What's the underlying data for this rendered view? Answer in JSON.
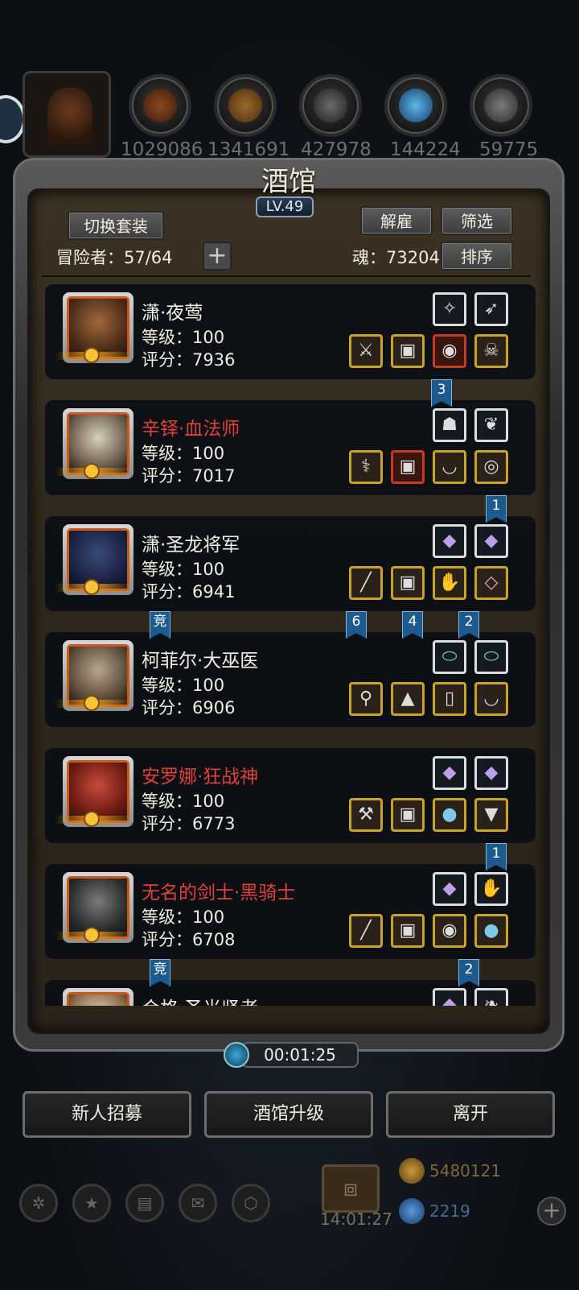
{
  "resources": [
    {
      "icon": "hero-portrait-icon",
      "value": ""
    },
    {
      "icon": "meat-icon",
      "value": "1029086"
    },
    {
      "icon": "wood-icon",
      "value": "1341691"
    },
    {
      "icon": "iron-icon",
      "value": "427978"
    },
    {
      "icon": "crystal-icon",
      "value": "144224"
    },
    {
      "icon": "steel-icon",
      "value": "59775"
    }
  ],
  "panel": {
    "title": "酒馆",
    "level": "LV.49",
    "switch_outfit": "切换套装",
    "dismiss": "解雇",
    "filter": "筛选",
    "sort": "排序",
    "adventurers": "冒险者：57/64",
    "plus": "+",
    "soul": "魂：73204"
  },
  "colors": {
    "name_default": "#f3efe6",
    "name_red": "#e0413a",
    "gold_frame": "#c9a227",
    "silver_frame": "#d9dde0",
    "flag_blue": "#1f5a8f"
  },
  "heroes": [
    {
      "name": "潇·夜莺",
      "name_color": "default",
      "level": "等级：100",
      "score": "评分：7936",
      "top_equip": [
        "sigil-icon",
        "bow-icon"
      ],
      "bottom_equip": [
        "dagger-icon",
        "armor-icon",
        "shield-icon",
        "skull-icon"
      ]
    },
    {
      "name": "辛铎·血法师",
      "name_color": "red",
      "level": "等级：100",
      "score": "评分：7017",
      "top_equip": [
        "mask-icon",
        "cloak-icon"
      ],
      "bottom_equip": [
        "staff-icon",
        "armor-icon",
        "necklace-icon",
        "ring-icon"
      ]
    },
    {
      "name": "潇·圣龙将军",
      "name_color": "default",
      "level": "等级：100",
      "score": "评分：6941",
      "top_equip": [
        "gem-icon",
        "gem-icon"
      ],
      "bottom_equip": [
        "spear-icon",
        "armor-icon",
        "gauntlet-icon",
        "rune-icon"
      ]
    },
    {
      "name": "柯菲尔·大巫医",
      "name_color": "default",
      "level": "等级：100",
      "score": "评分：6906",
      "top_equip": [
        "disk-icon",
        "disk-icon"
      ],
      "bottom_equip": [
        "wand-icon",
        "robe-icon",
        "bracer-icon",
        "necklace-icon"
      ]
    },
    {
      "name": "安罗娜·狂战神",
      "name_color": "red",
      "level": "等级：100",
      "score": "评分：6773",
      "top_equip": [
        "gem-icon",
        "gem-icon"
      ],
      "bottom_equip": [
        "axe-icon",
        "armor-icon",
        "orb-icon",
        "boot-icon"
      ]
    },
    {
      "name": "无名的剑士·黑骑士",
      "name_color": "red",
      "level": "等级：100",
      "score": "评分：6708",
      "top_equip": [
        "gem-icon",
        "glove-icon"
      ],
      "bottom_equip": [
        "sword-icon",
        "armor-icon",
        "shield-icon",
        "orb-icon"
      ]
    },
    {
      "name": "合格·圣光贤者",
      "name_color": "default",
      "level": "",
      "score": "",
      "top_equip": [
        "gem-icon",
        "feather-icon"
      ],
      "bottom_equip": []
    }
  ],
  "flags": [
    {
      "text": "3"
    },
    {
      "text": "1"
    },
    {
      "text": "竞"
    },
    {
      "text": "6"
    },
    {
      "text": "4"
    },
    {
      "text": "2"
    },
    {
      "text": "1"
    },
    {
      "text": "竞"
    },
    {
      "text": "2"
    }
  ],
  "timer": "00:01:25",
  "actions": {
    "recruit": "新人招募",
    "upgrade": "酒馆升级",
    "leave": "离开"
  },
  "dock": {
    "clock": "14:01:27",
    "gold": "5480121",
    "gems": "2219"
  }
}
